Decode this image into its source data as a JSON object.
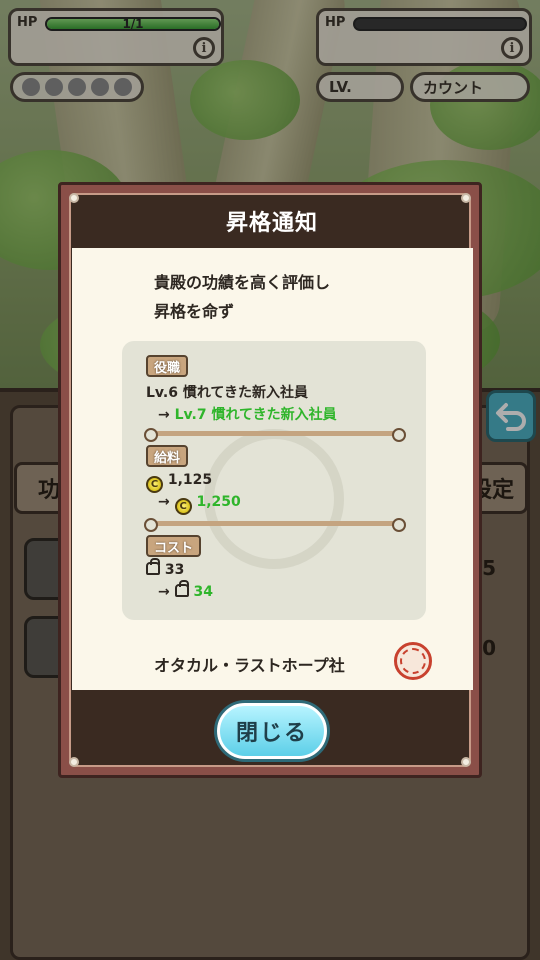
{
  "hud": {
    "left": {
      "hp_label": "HP",
      "hp_value": "1/1",
      "hp_fraction": 1.0,
      "info_icon": "i"
    },
    "right": {
      "hp_label": "HP",
      "hp_fraction": 0.0,
      "info_icon": "i"
    },
    "party_slots": 5,
    "level_label": "LV.",
    "count_label": "カウント"
  },
  "background_panel": {
    "tab_left_label": "功",
    "tab_right_label": "設定",
    "row_values": [
      "5",
      "0"
    ]
  },
  "popup": {
    "title": "昇格通知",
    "message_line1": "貴殿の功績を高く評価し",
    "message_line2": "昇格を命ず",
    "role": {
      "tag": "役職",
      "current": "Lv.6 慣れてきた新入社員",
      "arrow": "→",
      "next": "Lv.7 慣れてきた新入社員"
    },
    "salary": {
      "tag": "給料",
      "coin_symbol": "C",
      "current": "1,125",
      "arrow": "→",
      "next": "1,250"
    },
    "cost": {
      "tag": "コスト",
      "current": "33",
      "arrow": "→",
      "next": "34"
    },
    "signature": "オタカル・ラストホープ社",
    "close_label": "閉じる"
  },
  "colors": {
    "green_value": "#2fb52b",
    "popup_frame": "#8a4f48",
    "header_bg": "#3a2a21",
    "paper": "#fbf7ea",
    "close_button": "#5ccfe8",
    "seal": "#c8412e"
  },
  "icons": [
    "info-icon",
    "coin-icon",
    "weight-icon",
    "back-arrow-icon",
    "company-seal-icon"
  ]
}
